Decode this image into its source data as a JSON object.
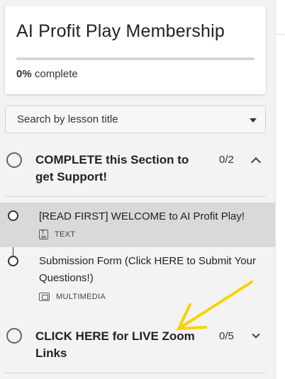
{
  "course": {
    "title": "AI Profit Play Membership",
    "progress_value": "0%",
    "progress_suffix": "complete",
    "progress_fraction": 0
  },
  "search": {
    "placeholder": "Search by lesson title"
  },
  "sections": [
    {
      "title": "COMPLETE this Section to get Support!",
      "count": "0/2",
      "expanded": true,
      "lessons": [
        {
          "title": "[READ FIRST] WELCOME to AI Profit Play!",
          "type": "TEXT",
          "icon": "text-document-icon",
          "active": true
        },
        {
          "title": "Submission Form (Click HERE to Submit Your Questions!)",
          "type": "MULTIMEDIA",
          "icon": "multimedia-icon",
          "active": false
        }
      ]
    },
    {
      "title": "CLICK HERE for LIVE Zoom Links",
      "count": "0/5",
      "expanded": false
    }
  ],
  "annotation": {
    "arrow_color": "#f5d400"
  },
  "colors": {
    "active_row": "#d9d9db",
    "background": "#f3f3f3"
  }
}
